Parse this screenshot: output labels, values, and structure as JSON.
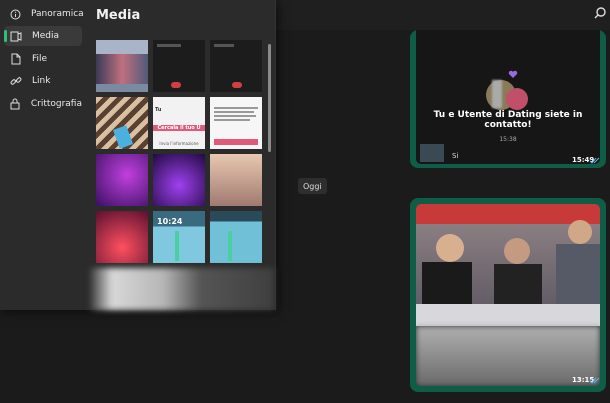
{
  "nav": {
    "items": [
      {
        "label": "Panoramica",
        "icon": "info-icon"
      },
      {
        "label": "Media",
        "icon": "media-icon"
      },
      {
        "label": "File",
        "icon": "file-icon"
      },
      {
        "label": "Link",
        "icon": "link-icon"
      },
      {
        "label": "Crittografia",
        "icon": "lock-icon"
      }
    ],
    "active": "Media"
  },
  "media": {
    "title": "Media",
    "thumb_texts": {
      "t6_a": "Tu",
      "t6_b": "Cercala il tuo U",
      "t6_c": "Invia l'informazione",
      "t10_a": "10:24"
    }
  },
  "chat": {
    "date_chip": "Oggi",
    "messages": [
      {
        "headline": "Tu e Utente di Dating siete in contatto!",
        "inner_time": "15:38",
        "reply_label": "Si",
        "timestamp": "15:49"
      },
      {
        "timestamp": "13:15"
      }
    ]
  },
  "colors": {
    "accent": "#2fbf7a",
    "bubble": "#0f5d47",
    "panel": "#2b2b2b",
    "background": "#1b1b1b",
    "tick": "#53bdeb"
  }
}
